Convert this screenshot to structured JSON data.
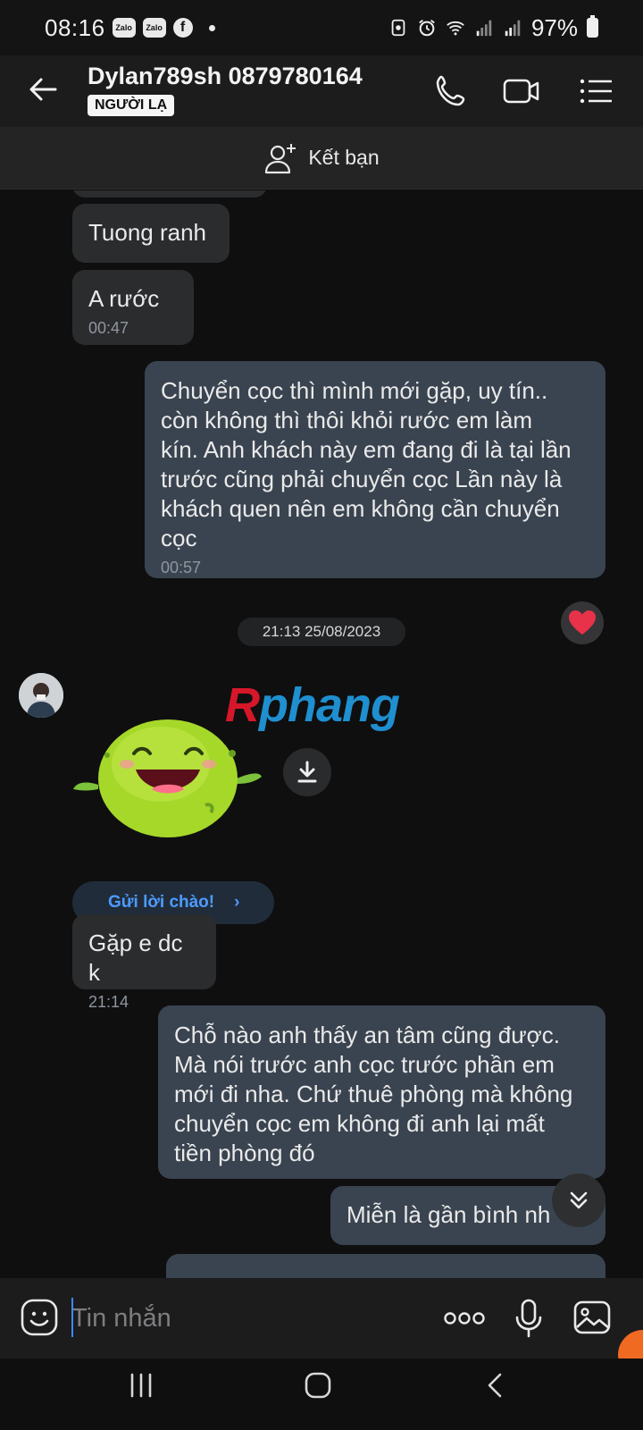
{
  "status_bar": {
    "time": "08:16",
    "app_icons": [
      "Zalo",
      "Zalo"
    ],
    "battery": "97%"
  },
  "header": {
    "title": "Dylan789sh 0879780164",
    "badge": "NGƯỜI LẠ"
  },
  "add_friend": {
    "label": "Kết bạn"
  },
  "messages": [
    {
      "text": "Tuong ranh"
    },
    {
      "text": "A rước",
      "time": "00:47"
    },
    {
      "lines": [
        "Chuyển cọc thì mình mới gặp, uy tín..",
        "còn không thì thôi khỏi rước em làm",
        "kín. Anh khách này em đang đi là tại lần",
        "trước cũng phải chuyển cọc Lần này là",
        "khách quen nên em không cần chuyển",
        "cọc"
      ],
      "time": "00:57"
    },
    {
      "text": "Gặp e dc k",
      "time": "21:14"
    },
    {
      "lines": [
        "Chỗ nào anh thấy an tâm cũng được.",
        "Mà nói trước anh cọc trước phần em",
        "mới đi nha. Chứ thuê phòng mà không",
        "chuyển cọc em không đi anh lại mất",
        "tiền phòng đó"
      ]
    },
    {
      "text": "Miễn là gần bình nh"
    }
  ],
  "date_separator": "21:13 25/08/2023",
  "watermark": {
    "part1": "R",
    "part2": "phang"
  },
  "greet_button": {
    "label": "Gửi lời chào!",
    "chevron": "›"
  },
  "input": {
    "placeholder": "Tin nhắn"
  },
  "icons": {
    "back": "arrow-left-icon",
    "call": "phone-icon",
    "video": "video-camera-icon",
    "menu": "list-menu-icon",
    "sticker": "emoji-icon",
    "more": "more-dots-icon",
    "mic": "microphone-icon",
    "image": "image-icon"
  },
  "colors": {
    "incoming_bubble": "#2b2c2e",
    "outgoing_bubble": "#3a4450",
    "accent": "#4d9bff",
    "heart": "#e8324a"
  }
}
